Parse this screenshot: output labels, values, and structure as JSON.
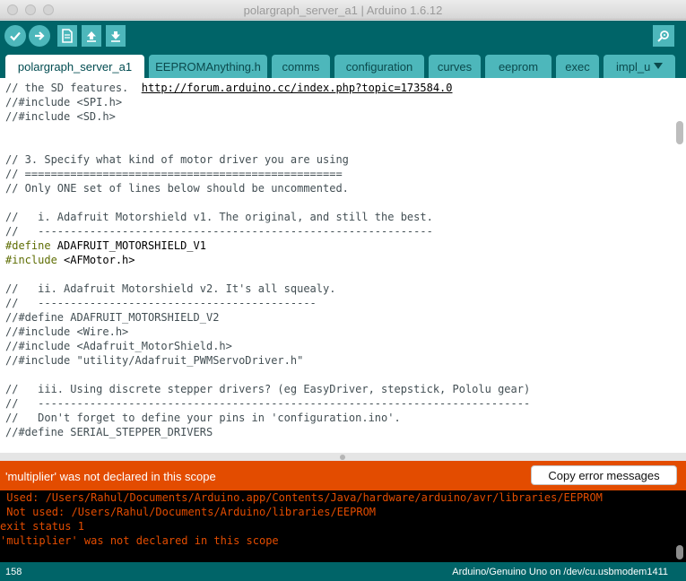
{
  "window": {
    "title": "polargraph_server_a1 | Arduino 1.6.12"
  },
  "toolbar": {
    "verify_icon": "check-icon",
    "upload_icon": "arrow-right-icon",
    "new_icon": "document-icon",
    "open_icon": "arrow-up-icon",
    "save_icon": "arrow-down-icon",
    "serial_monitor_icon": "magnifier-icon"
  },
  "tabs": [
    {
      "label": "polargraph_server_a1",
      "active": true
    },
    {
      "label": "EEPROMAnything.h"
    },
    {
      "label": "comms"
    },
    {
      "label": "configuration"
    },
    {
      "label": "curves"
    },
    {
      "label": "eeprom"
    },
    {
      "label": "exec"
    },
    {
      "label": "impl_u"
    }
  ],
  "tab_menu_icon": "triangle-down-icon",
  "editor": {
    "lines": [
      {
        "segments": [
          {
            "t": "// the SD features.  "
          },
          {
            "t": "http://forum.arduino.cc/index.php?topic=173584.0",
            "c": "url"
          }
        ]
      },
      {
        "segments": [
          {
            "t": "//#include <SPI.h>"
          }
        ]
      },
      {
        "segments": [
          {
            "t": "//#include <SD.h>"
          }
        ]
      },
      {
        "segments": [
          {
            "t": ""
          }
        ]
      },
      {
        "segments": [
          {
            "t": ""
          }
        ]
      },
      {
        "segments": [
          {
            "t": "// 3. Specify what kind of motor driver you are using"
          }
        ]
      },
      {
        "segments": [
          {
            "t": "// ================================================="
          }
        ]
      },
      {
        "segments": [
          {
            "t": "// Only ONE set of lines below should be uncommented."
          }
        ]
      },
      {
        "segments": [
          {
            "t": ""
          }
        ]
      },
      {
        "segments": [
          {
            "t": "//   i. Adafruit Motorshield v1. The original, and still the best."
          }
        ]
      },
      {
        "segments": [
          {
            "t": "//   -------------------------------------------------------------"
          }
        ]
      },
      {
        "segments": [
          {
            "t": "#define",
            "c": "kw"
          },
          {
            "t": " ADAFRUIT_MOTORSHIELD_V1",
            "c": "dim"
          }
        ]
      },
      {
        "segments": [
          {
            "t": "#include",
            "c": "kw"
          },
          {
            "t": " <AFMotor.h>",
            "c": "dim"
          }
        ]
      },
      {
        "segments": [
          {
            "t": ""
          }
        ]
      },
      {
        "segments": [
          {
            "t": "//   ii. Adafruit Motorshield v2. It's all squealy."
          }
        ]
      },
      {
        "segments": [
          {
            "t": "//   -------------------------------------------"
          }
        ]
      },
      {
        "segments": [
          {
            "t": "//#define ADAFRUIT_MOTORSHIELD_V2"
          }
        ]
      },
      {
        "segments": [
          {
            "t": "//#include <Wire.h>"
          }
        ]
      },
      {
        "segments": [
          {
            "t": "//#include <Adafruit_MotorShield.h>"
          }
        ]
      },
      {
        "segments": [
          {
            "t": "//#include \"utility/Adafruit_PWMServoDriver.h\""
          }
        ]
      },
      {
        "segments": [
          {
            "t": ""
          }
        ]
      },
      {
        "segments": [
          {
            "t": "//   iii. Using discrete stepper drivers? (eg EasyDriver, stepstick, Pololu gear)"
          }
        ]
      },
      {
        "segments": [
          {
            "t": "//   ----------------------------------------------------------------------------"
          }
        ]
      },
      {
        "segments": [
          {
            "t": "//   Don't forget to define your pins in 'configuration.ino'."
          }
        ]
      },
      {
        "segments": [
          {
            "t": "//#define SERIAL_STEPPER_DRIVERS"
          }
        ]
      }
    ]
  },
  "error": {
    "message": "'multiplier' was not declared in this scope",
    "copy_button": "Copy error messages"
  },
  "console": {
    "lines": [
      " Used: /Users/Rahul/Documents/Arduino.app/Contents/Java/hardware/arduino/avr/libraries/EEPROM",
      " Not used: /Users/Rahul/Documents/Arduino/libraries/EEPROM",
      "exit status 1",
      "'multiplier' was not declared in this scope"
    ]
  },
  "status": {
    "line_number": "158",
    "board": "Arduino/Genuino Uno on /dev/cu.usbmodem1411"
  },
  "colors": {
    "toolbar": "#006468",
    "button": "#4db7bb",
    "error": "#e34c00",
    "console_bg": "#000000"
  }
}
